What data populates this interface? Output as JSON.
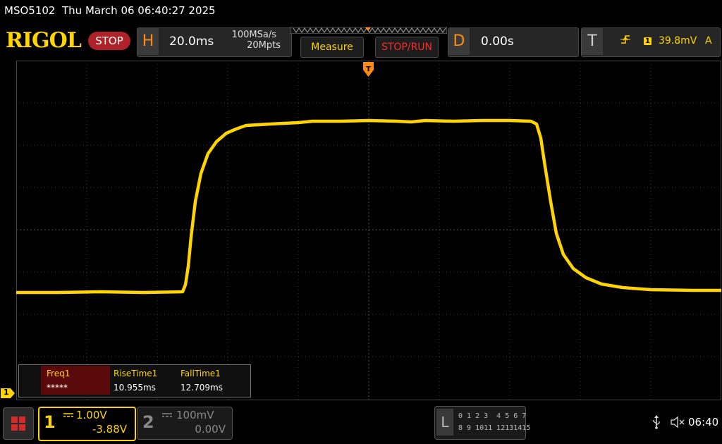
{
  "titlebar": {
    "model": "MSO5102",
    "datetime": "Thu March 06 06:40:27 2025"
  },
  "brand": {
    "logo": "RIGOL",
    "run_state": "STOP"
  },
  "horizontal": {
    "tag": "H",
    "timebase": "20.0ms",
    "sample_rate": "100MSa/s",
    "memory_depth": "20Mpts"
  },
  "buttons": {
    "measure": "Measure",
    "stop_run": "STOP/RUN"
  },
  "delay": {
    "tag": "D",
    "value": "0.00s"
  },
  "trigger": {
    "tag": "T",
    "source_channel": "1",
    "level": "39.8mV",
    "mode": "A",
    "edge_icon": "rising-edge-icon"
  },
  "measurements": [
    {
      "label": "Freq1",
      "value": "*****"
    },
    {
      "label": "RiseTime1",
      "value": "10.955ms"
    },
    {
      "label": "FallTime1",
      "value": "12.709ms"
    }
  ],
  "channels": [
    {
      "number": "1",
      "scale": "1.00V",
      "offset": "-3.88V",
      "active": true
    },
    {
      "number": "2",
      "scale": "100mV",
      "offset": "0.00V",
      "active": false
    }
  ],
  "logic_analyzer": {
    "tag": "L",
    "row1": "0 1 2 3  4 5 6 7",
    "row2": "8 9 1011 12131415"
  },
  "status": {
    "time": "06:40"
  },
  "markers": {
    "channel_ground": "1"
  },
  "colors": {
    "ch1": "#ffd400",
    "accent_orange": "#ff8c1a",
    "stop_red": "#b0222a",
    "grid": "#3c3c3c"
  }
}
